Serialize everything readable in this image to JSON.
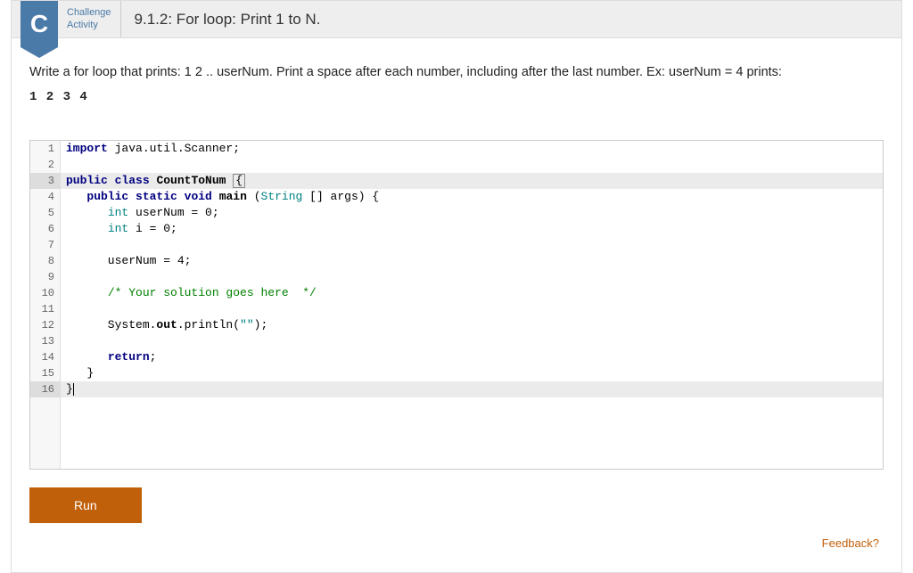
{
  "badge": {
    "letter": "C",
    "label1": "Challenge",
    "label2": "Activity"
  },
  "title": "9.1.2: For loop: Print 1 to N.",
  "instructions": "Write a for loop that prints: 1 2 .. userNum. Print a space after each number, including after the last number. Ex: userNum = 4 prints:",
  "example": "1 2 3 4",
  "run_label": "Run",
  "feedback_label": "Feedback?",
  "code": {
    "l1": {
      "kw": "import",
      "rest": " java.util.Scanner;"
    },
    "l3": {
      "kw1": "public",
      "kw2": "class",
      "cls": "CountToNum",
      "brace": "{"
    },
    "l4": {
      "kw1": "public",
      "kw2": "static",
      "kw3": "void",
      "m": "main",
      "p1": "(",
      "typ": "String",
      "p2": " [] args) {"
    },
    "l5": {
      "typ": "int",
      "rest": " userNum = 0;"
    },
    "l6": {
      "typ": "int",
      "rest": " i = 0;"
    },
    "l8": "      userNum = 4;",
    "l10": "/* Your solution goes here  */",
    "l12": {
      "p1": "      System.",
      "m": "out",
      "p2": ".println(",
      "s": "\"\"",
      "p3": ");"
    },
    "l14": {
      "kw": "return",
      "rest": ";"
    },
    "l15": "   }",
    "l16": "}"
  }
}
